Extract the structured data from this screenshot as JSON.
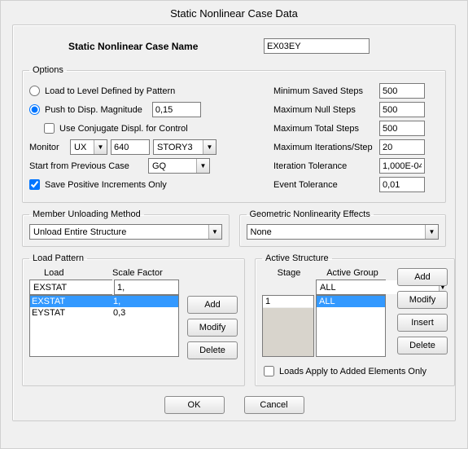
{
  "title": "Static Nonlinear Case  Data",
  "nameRow": {
    "label": "Static Nonlinear Case  Name",
    "value": "EX03EY"
  },
  "options": {
    "legend": "Options",
    "loadToLevel": "Load to Level Defined by Pattern",
    "pushToDisp": "Push to Disp. Magnitude",
    "pushValue": "0,15",
    "useConjugate": "Use Conjugate Displ. for Control",
    "monitorLabel": "Monitor",
    "monitorDof": "UX",
    "monitorVal": "640",
    "monitorStory": "STORY3",
    "startFromLabel": "Start from Previous Case",
    "startFromValue": "GQ",
    "savePositive": "Save Positive Increments Only",
    "right": {
      "minSaved": {
        "label": "Minimum Saved Steps",
        "value": "500"
      },
      "maxNull": {
        "label": "Maximum Null Steps",
        "value": "500"
      },
      "maxTotal": {
        "label": "Maximum Total Steps",
        "value": "500"
      },
      "maxIter": {
        "label": "Maximum Iterations/Step",
        "value": "20"
      },
      "iterTol": {
        "label": "Iteration Tolerance",
        "value": "1,000E-04"
      },
      "eventTol": {
        "label": "Event Tolerance",
        "value": "0,01"
      }
    }
  },
  "member": {
    "legend": "Member Unloading Method",
    "value": "Unload Entire Structure"
  },
  "geom": {
    "legend": "Geometric Nonlinearity Effects",
    "value": "None"
  },
  "loadPattern": {
    "legend": "Load Pattern",
    "headLoad": "Load",
    "headScale": "Scale Factor",
    "inputLoad": "EXSTAT",
    "inputScale": "1,",
    "rows": [
      {
        "load": "EXSTAT",
        "scale": "1,"
      },
      {
        "load": "EYSTAT",
        "scale": "0,3"
      }
    ],
    "btnAdd": "Add",
    "btnModify": "Modify",
    "btnDelete": "Delete"
  },
  "active": {
    "legend": "Active Structure",
    "headStage": "Stage",
    "headGroup": "Active Group",
    "groupCombo": "ALL",
    "stageItems": [
      "1"
    ],
    "groupItems": [
      "ALL"
    ],
    "btnAdd": "Add",
    "btnModify": "Modify",
    "btnInsert": "Insert",
    "btnDelete": "Delete",
    "loadsApply": "Loads Apply to Added Elements Only"
  },
  "dlg": {
    "ok": "OK",
    "cancel": "Cancel"
  }
}
